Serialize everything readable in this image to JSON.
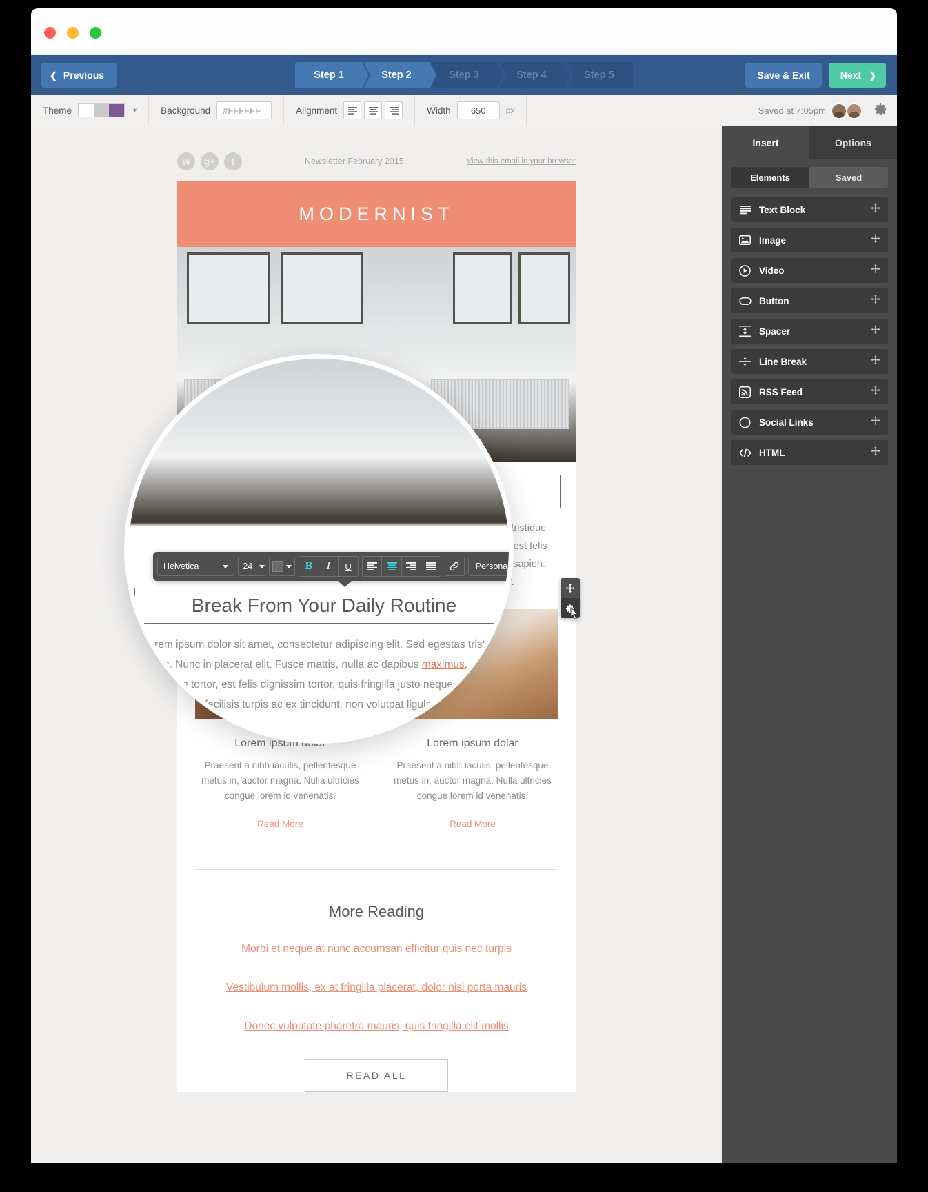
{
  "window": {
    "traffic_lights": [
      "close",
      "minimize",
      "zoom"
    ]
  },
  "header": {
    "previous_label": "Previous",
    "save_exit_label": "Save & Exit",
    "next_label": "Next",
    "steps": [
      {
        "label": "Step 1",
        "state": "complete"
      },
      {
        "label": "Step 2",
        "state": "active"
      },
      {
        "label": "Step 3",
        "state": "upcoming"
      },
      {
        "label": "Step 4",
        "state": "upcoming"
      },
      {
        "label": "Step 5",
        "state": "upcoming"
      }
    ],
    "colors": {
      "bar": "#33598d",
      "step_active": "#4479b4",
      "next": "#4ecba5"
    }
  },
  "toolbar": {
    "theme_label": "Theme",
    "theme_swatches": [
      "#FFFFFF",
      "#C9C9C9",
      "#7E5A95"
    ],
    "background_label": "Background",
    "background_value": "#FFFFFF",
    "alignment_label": "Alignment",
    "alignment_options": [
      "align-left",
      "align-center",
      "align-right"
    ],
    "alignment_selected": "align-center",
    "width_label": "Width",
    "width_value": "650",
    "width_unit": "px",
    "saved_status": "Saved at 7:05pm",
    "gear_icon": "gear-icon"
  },
  "sidebar": {
    "tabs": [
      {
        "label": "Insert",
        "active": true
      },
      {
        "label": "Options",
        "active": false
      }
    ],
    "segments": [
      {
        "label": "Elements",
        "active": true
      },
      {
        "label": "Saved",
        "active": false
      }
    ],
    "elements": [
      {
        "label": "Text Block",
        "icon": "text-lines-icon"
      },
      {
        "label": "Image",
        "icon": "picture-icon"
      },
      {
        "label": "Video",
        "icon": "play-circle-icon"
      },
      {
        "label": "Button",
        "icon": "pill-button-icon"
      },
      {
        "label": "Spacer",
        "icon": "spacer-icon"
      },
      {
        "label": "Line Break",
        "icon": "line-break-icon"
      },
      {
        "label": "RSS Feed",
        "icon": "rss-icon"
      },
      {
        "label": "Social Links",
        "icon": "circle-icon"
      },
      {
        "label": "HTML",
        "icon": "code-icon"
      }
    ],
    "drag_handle_icon": "move-handle-icon"
  },
  "email": {
    "preheader": {
      "social_icons": [
        "twitter-icon",
        "google-plus-icon",
        "facebook-icon"
      ],
      "issue": "Newsletter February 2015",
      "browser_link": "View this email in your browser"
    },
    "brand": "MODERNIST",
    "brand_color": "#EF8E74",
    "headline": "Break From Your Daily Routine",
    "lead_before": "Lorem ipsum dolor sit amet, consectetur adipiscing elit. Sed egestas tristique luctus. Nunc in placerat elit. Fusce mattis, nulla ac dapibus ",
    "lead_link": "maximus",
    "lead_after": ", est felis dignissim tortor, est felis dignissim tortor, quis fringilla justo neque ac sapien. Nunc facilisis turpis ac ex tincidunt, non volutpat ligula efficitur.",
    "columns": [
      {
        "heading": "Lorem ipsum dolar",
        "body": "Praesent a nibh iaculis, pellentesque metus in, auctor magna. Nulla ultricies congue lorem id venenatis.",
        "link": "Read More"
      },
      {
        "heading": "Lorem ipsum dolar",
        "body": "Praesent a nibh iaculis, pellentesque metus in, auctor magna. Nulla ultricies congue lorem id venenatis.",
        "link": "Read More"
      }
    ],
    "more_reading_title": "More Reading",
    "more_reading_links": [
      "Morbi et neque at nunc accumsan efficitur quis nec turpis",
      "Vestibulum mollis, ex at fringilla placerat, dolor nisi porta mauris",
      "Donec vulputate pharetra mauris, quis fringilla elit mollis"
    ],
    "read_all_label": "READ ALL",
    "link_color": "#EF8E74"
  },
  "format_toolbar": {
    "font_family": "Helvetica",
    "font_size": "24",
    "text_color": "#6A6A6A",
    "bold": "B",
    "italic": "I",
    "underline": "U",
    "bold_active": true,
    "align_center_active": true,
    "link_icon": "link-icon",
    "personalize_label": "Personalize",
    "accent_color": "#3FD0E0"
  },
  "block_controls": {
    "move_icon": "move-handle-icon",
    "settings_icon": "gear-icon"
  }
}
